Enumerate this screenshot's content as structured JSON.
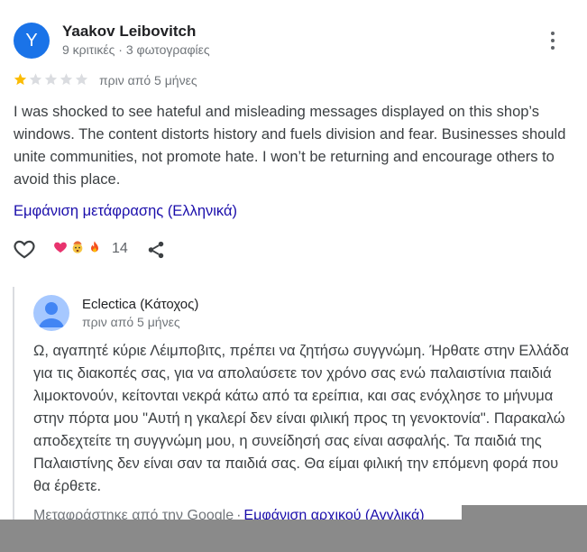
{
  "review": {
    "avatar_letter": "Y",
    "author_name": "Yaakov Leibovitch",
    "author_meta": "9 κριτικές · 3 φωτογραφίες",
    "rating": 1,
    "rating_max": 5,
    "time_ago": "πριν από 5 μήνες",
    "text": "I was shocked to see hateful and misleading messages displayed on this shop’s windows. The content distorts history and fuels division and fear. Businesses should unite communities, not promote hate. I won’t be returning and encourage others to avoid this place.",
    "translate_link": "Εμφάνιση μετάφρασης (Ελληνικά)",
    "reaction_count": "14"
  },
  "owner_reply": {
    "name": "Eclectica (Κάτοχος)",
    "time_ago": "πριν από 5 μήνες",
    "text": "Ω, αγαπητέ κύριε Λέιμποβιτς, πρέπει να ζητήσω συγγνώμη. Ήρθατε στην Ελλάδα για τις διακοπές σας, για να απολαύσετε τον χρόνο σας ενώ παλαιστίνια παιδιά λιμοκτονούν, κείτονται νεκρά κάτω από τα ερείπια, και σας ενόχλησε το μήνυμα στην πόρτα μου \"Αυτή η γκαλερί δεν είναι φιλική προς τη γενοκτονία\". Παρακαλώ αποδεχτείτε τη συγγνώμη μου, η συνείδησή σας είναι ασφαλής. Τα παιδιά της Παλαιστίνης δεν είναι σαν τα παιδιά σας. Θα είμαι φιλική την επόμενη φορά που θα έρθετε.",
    "translated_by": "Μεταφράστηκε από την Google",
    "separator": "·",
    "show_original": "Εμφάνιση αρχικού (Αγγλικά)"
  },
  "colors": {
    "avatar_bg": "#1a73e8",
    "star_filled": "#fbbc04",
    "star_empty": "#dadce0",
    "link": "#1a0dab"
  }
}
